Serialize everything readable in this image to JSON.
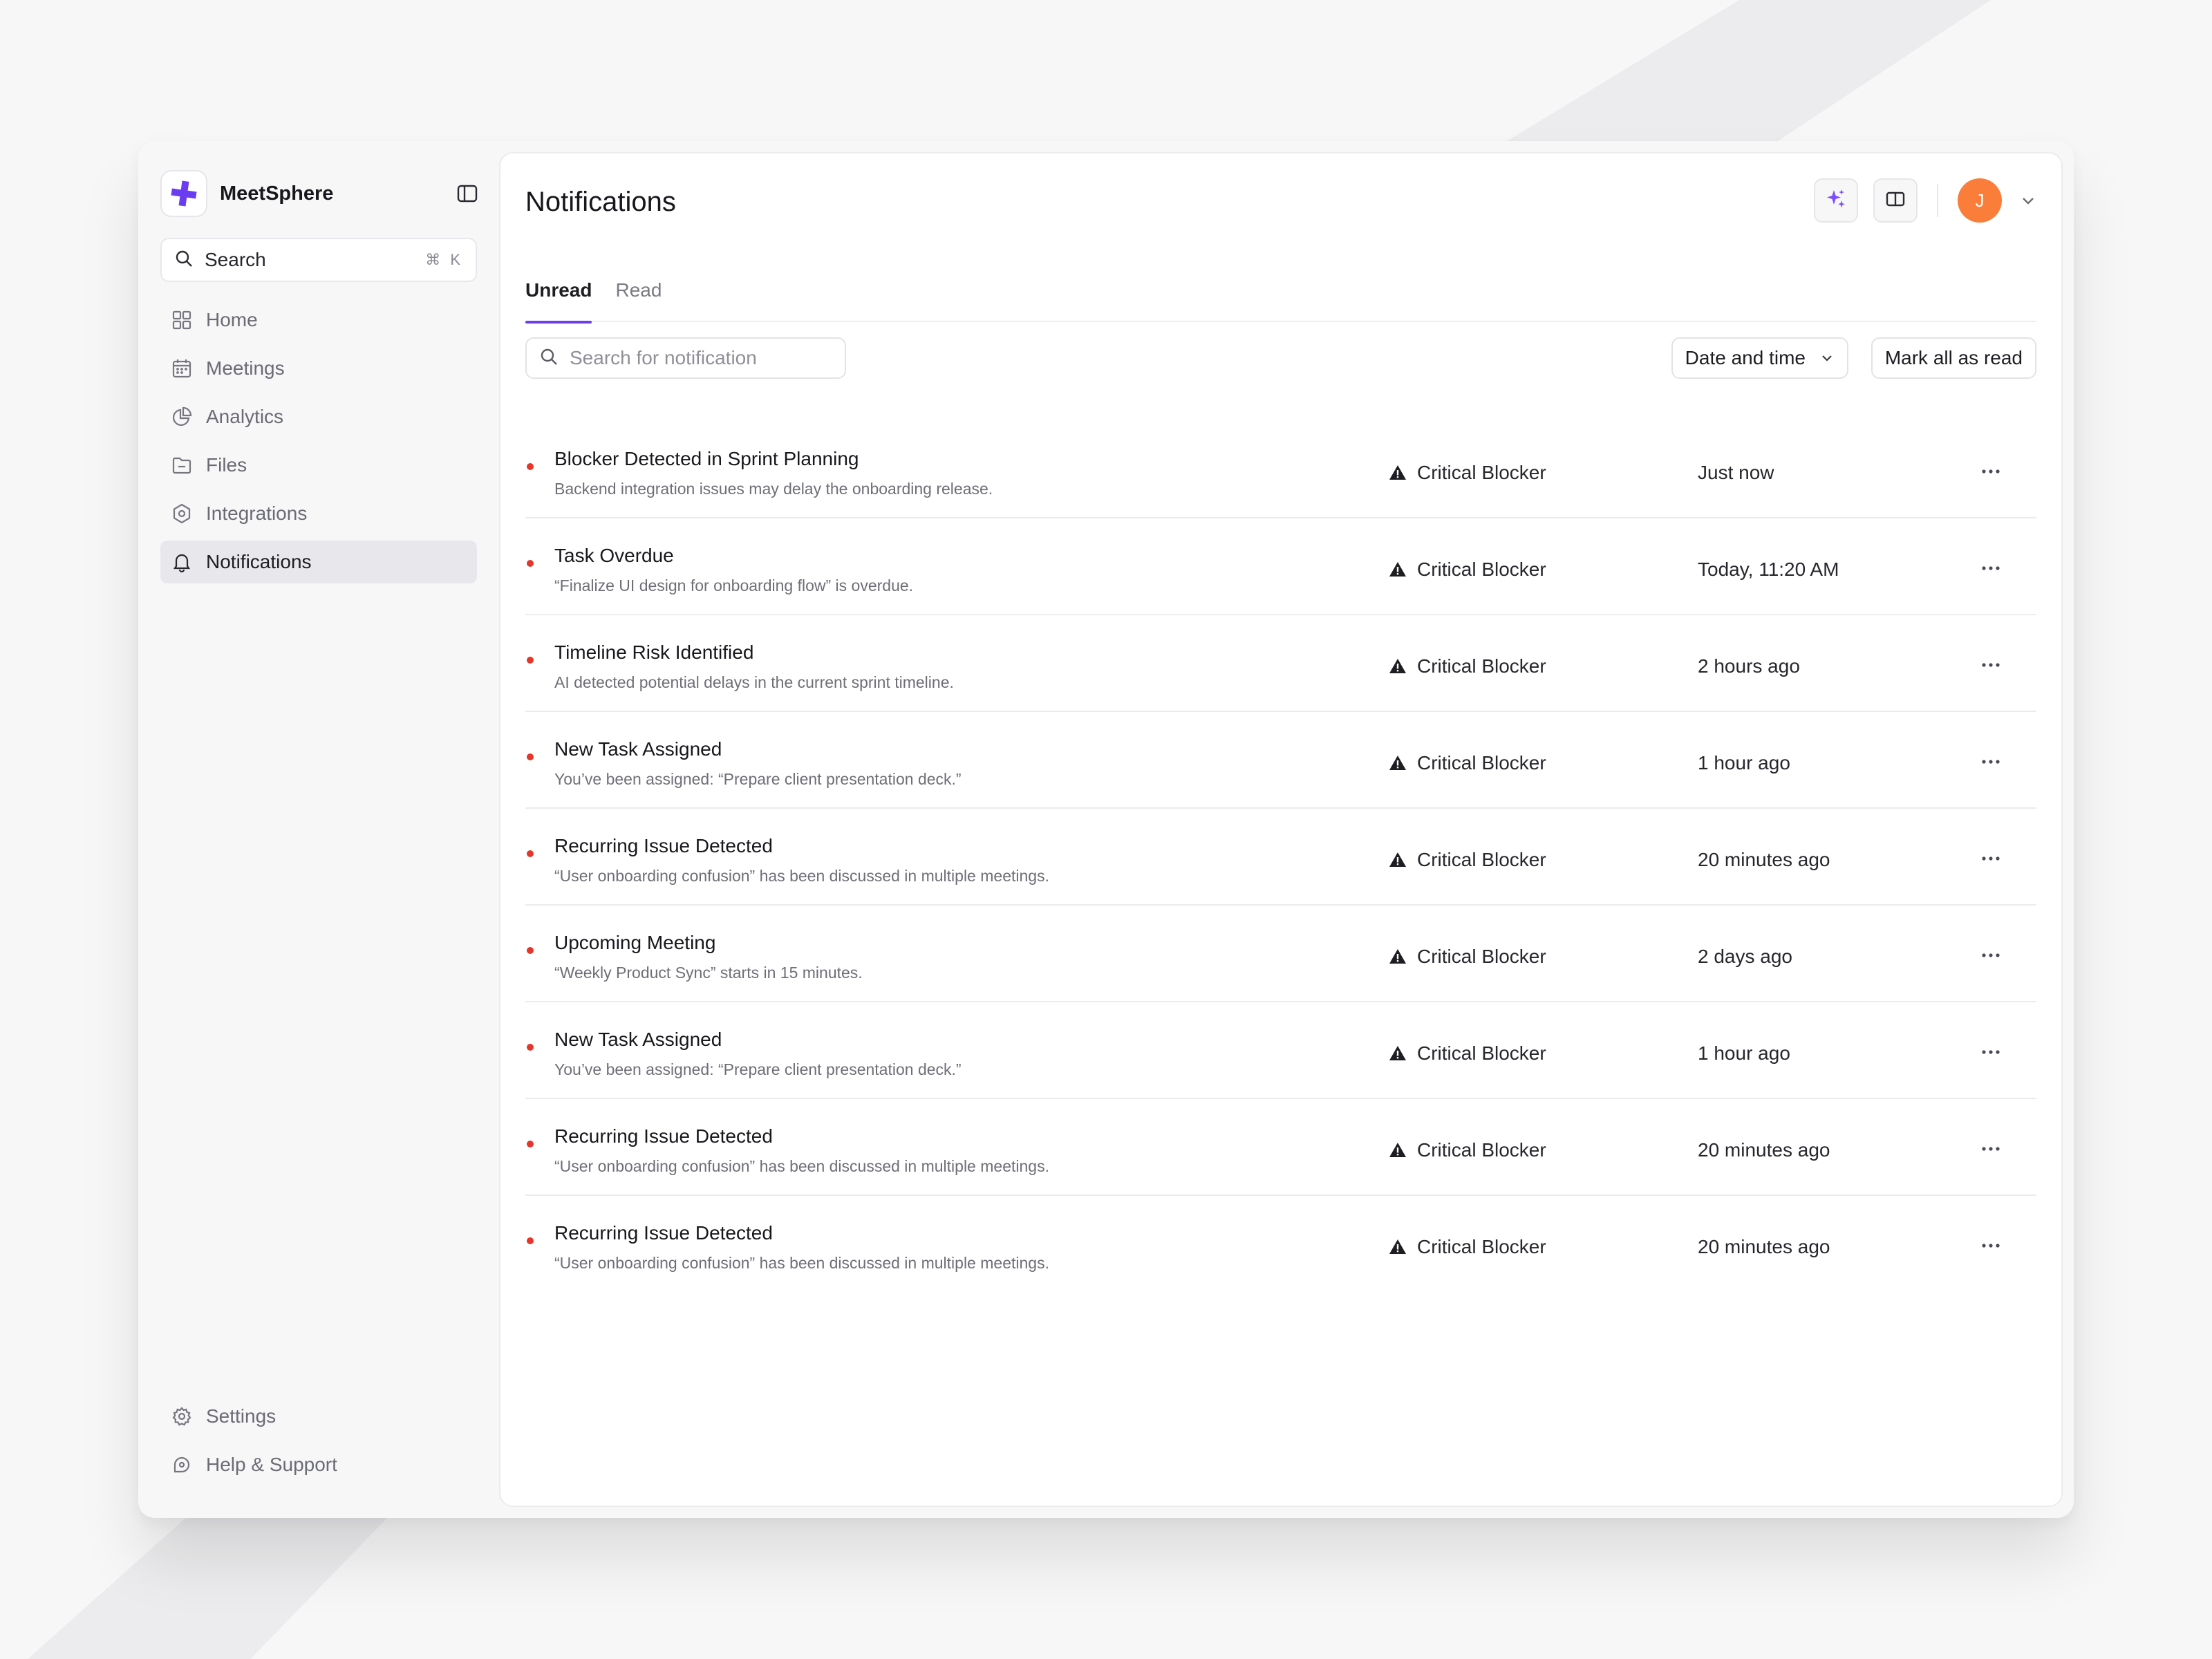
{
  "app": {
    "name": "MeetSphere",
    "brand_color": "#6a3df0"
  },
  "sidebar": {
    "search": {
      "label": "Search",
      "shortcut": "⌘ K"
    },
    "items": [
      {
        "label": "Home",
        "icon": "grid-icon"
      },
      {
        "label": "Meetings",
        "icon": "calendar-icon"
      },
      {
        "label": "Analytics",
        "icon": "pie-chart-icon"
      },
      {
        "label": "Files",
        "icon": "folder-icon"
      },
      {
        "label": "Integrations",
        "icon": "hexagon-icon"
      },
      {
        "label": "Notifications",
        "icon": "bell-icon",
        "active": true
      }
    ],
    "bottom": [
      {
        "label": "Settings",
        "icon": "gear-icon"
      },
      {
        "label": "Help & Support",
        "icon": "support-icon"
      }
    ]
  },
  "header": {
    "title": "Notifications",
    "avatar_initial": "J",
    "avatar_color": "#fb7d3a"
  },
  "tabs": [
    {
      "label": "Unread",
      "active": true
    },
    {
      "label": "Read",
      "active": false
    }
  ],
  "toolbar": {
    "search_placeholder": "Search for notification",
    "sort_label": "Date and time",
    "mark_all_label": "Mark all as read"
  },
  "notifications": [
    {
      "title": "Blocker Detected in Sprint Planning",
      "description": "Backend integration issues may delay the onboarding release.",
      "tag": "Critical Blocker",
      "time": "Just now",
      "unread": true
    },
    {
      "title": "Task Overdue",
      "description": "“Finalize UI design for onboarding flow” is overdue.",
      "tag": "Critical Blocker",
      "time": "Today, 11:20 AM",
      "unread": true
    },
    {
      "title": "Timeline Risk Identified",
      "description": "AI detected potential delays in the current sprint timeline.",
      "tag": "Critical Blocker",
      "time": "2 hours ago",
      "unread": true
    },
    {
      "title": "New Task Assigned",
      "description": "You’ve been assigned: “Prepare client presentation deck.”",
      "tag": "Critical Blocker",
      "time": "1 hour ago",
      "unread": true
    },
    {
      "title": "Recurring Issue Detected",
      "description": "“User onboarding confusion” has been discussed in multiple meetings.",
      "tag": "Critical Blocker",
      "time": "20 minutes ago",
      "unread": true
    },
    {
      "title": "Upcoming Meeting",
      "description": "“Weekly Product Sync” starts in 15 minutes.",
      "tag": "Critical Blocker",
      "time": "2 days ago",
      "unread": true
    },
    {
      "title": "New Task Assigned",
      "description": "You’ve been assigned: “Prepare client presentation deck.”",
      "tag": "Critical Blocker",
      "time": "1 hour ago",
      "unread": true
    },
    {
      "title": "Recurring Issue Detected",
      "description": "“User onboarding confusion” has been discussed in multiple meetings.",
      "tag": "Critical Blocker",
      "time": "20 minutes ago",
      "unread": true
    },
    {
      "title": "Recurring Issue Detected",
      "description": "“User onboarding confusion” has been discussed in multiple meetings.",
      "tag": "Critical Blocker",
      "time": "20 minutes ago",
      "unread": true
    }
  ]
}
